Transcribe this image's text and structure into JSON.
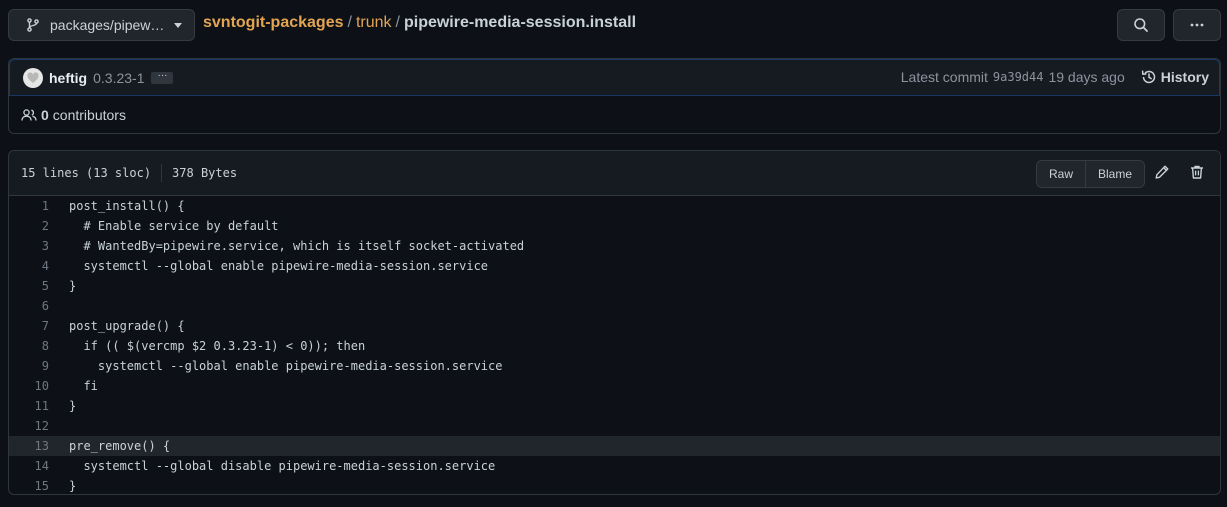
{
  "topbar": {
    "branch_label": "packages/pipew…",
    "repo": "svntogit-packages",
    "dir": "trunk",
    "sep": "/",
    "file": "pipewire-media-session.install"
  },
  "commit": {
    "author": "heftig",
    "message": "0.3.23-1",
    "ellipsis": "···",
    "latest_label": "Latest commit",
    "sha": "9a39d44",
    "age": "19 days ago",
    "history_label": "History",
    "contributors_count": "0",
    "contributors_label": "contributors"
  },
  "file": {
    "lines_info": "15 lines (13 sloc)",
    "size": "378 Bytes",
    "raw_label": "Raw",
    "blame_label": "Blame",
    "highlighted_line": 13,
    "lines": [
      "post_install() {",
      "  # Enable service by default",
      "  # WantedBy=pipewire.service, which is itself socket-activated",
      "  systemctl --global enable pipewire-media-session.service",
      "}",
      "",
      "post_upgrade() {",
      "  if (( $(vercmp $2 0.3.23-1) < 0)); then",
      "    systemctl --global enable pipewire-media-session.service",
      "  fi",
      "}",
      "",
      "pre_remove() {",
      "  systemctl --global disable pipewire-media-session.service",
      "}"
    ]
  },
  "icons": {
    "branch": "git-branch-icon",
    "search": "search-icon",
    "more": "kebab-horizontal-icon",
    "history": "history-icon",
    "people": "people-icon",
    "edit": "pencil-icon",
    "delete": "trash-icon"
  }
}
